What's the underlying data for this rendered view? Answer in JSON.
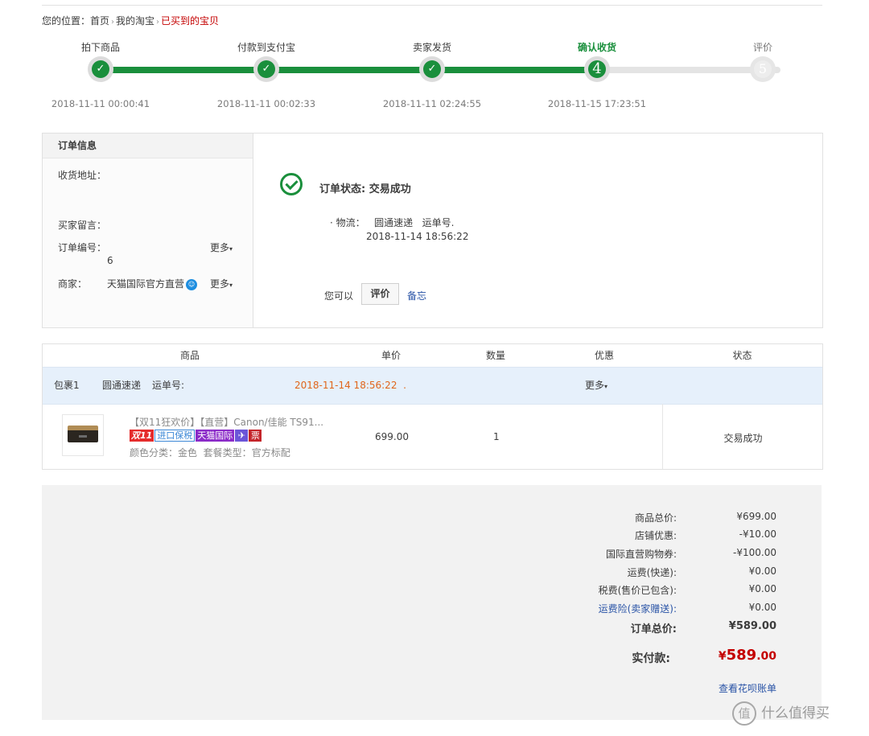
{
  "breadcrumb": {
    "prefix": "您的位置：",
    "items": [
      "首页",
      "我的淘宝"
    ],
    "current": "已买到的宝贝",
    "separator": "›"
  },
  "progress": {
    "steps": [
      {
        "label": "拍下商品",
        "time": "2018-11-11 00:00:41",
        "state": "done"
      },
      {
        "label": "付款到支付宝",
        "time": "2018-11-11 00:02:33",
        "state": "done"
      },
      {
        "label": "卖家发货",
        "time": "2018-11-11 02:24:55",
        "state": "done"
      },
      {
        "label": "确认收货",
        "time": "2018-11-15 17:23:51",
        "state": "current",
        "number": "4"
      },
      {
        "label": "评价",
        "time": "",
        "state": "pending",
        "number": "5"
      }
    ],
    "done_color": "#1a8f3c"
  },
  "order_info": {
    "header": "订单信息",
    "address_label": "收货地址：",
    "buyer_msg_label": "买家留言：",
    "order_no_label": "订单编号：",
    "order_no_value": "6",
    "merchant_label": "商家：",
    "merchant_value": "天猫国际官方直营",
    "more_label": "更多"
  },
  "status": {
    "title": "订单状态: 交易成功",
    "logistics_prefix": "· 物流：",
    "carrier": "圆通速递",
    "tracking_label": "运单号.",
    "logistics_time": "2018-11-14 18:56:22",
    "you_can": "您可以",
    "review_button": "评价",
    "memo_link": "备忘"
  },
  "goods": {
    "headers": [
      "商品",
      "单价",
      "数量",
      "优惠",
      "状态"
    ],
    "package": {
      "name": "包裹1",
      "carrier": "圆通速递",
      "tracking_label": "运单号:",
      "time": "2018-11-14 18:56:22",
      "time_suffix": ".",
      "more_label": "更多"
    },
    "item": {
      "title": "【双11狂欢价】【直营】Canon/佳能 TS91...",
      "tags": [
        "双11",
        "进口保税",
        "天猫国际",
        "✈",
        "票"
      ],
      "sku_color_label": "颜色分类：",
      "sku_color_value": "金色",
      "sku_pkg_label": "套餐类型：",
      "sku_pkg_value": "官方标配",
      "price": "699.00",
      "quantity": "1",
      "status": "交易成功"
    }
  },
  "summary": {
    "rows": [
      {
        "label": "商品总价:",
        "value": "¥699.00"
      },
      {
        "label": "店铺优惠:",
        "value": "-¥10.00"
      },
      {
        "label": "国际直营购物券:",
        "value": "-¥100.00"
      },
      {
        "label": "运费(快递):",
        "value": "¥0.00"
      },
      {
        "label": "税费(售价已包含):",
        "value": "¥0.00"
      },
      {
        "label": "运费险(卖家赠送):",
        "value": "¥0.00"
      }
    ],
    "total_label": "订单总价:",
    "total_value": "¥589.00",
    "paid_label": "实付款:",
    "paid_currency": "¥",
    "paid_int": "589",
    "paid_dec": ".00",
    "huabei_link": "查看花呗账单"
  },
  "watermark": {
    "icon_glyph": "值",
    "text": "什么值得买"
  }
}
